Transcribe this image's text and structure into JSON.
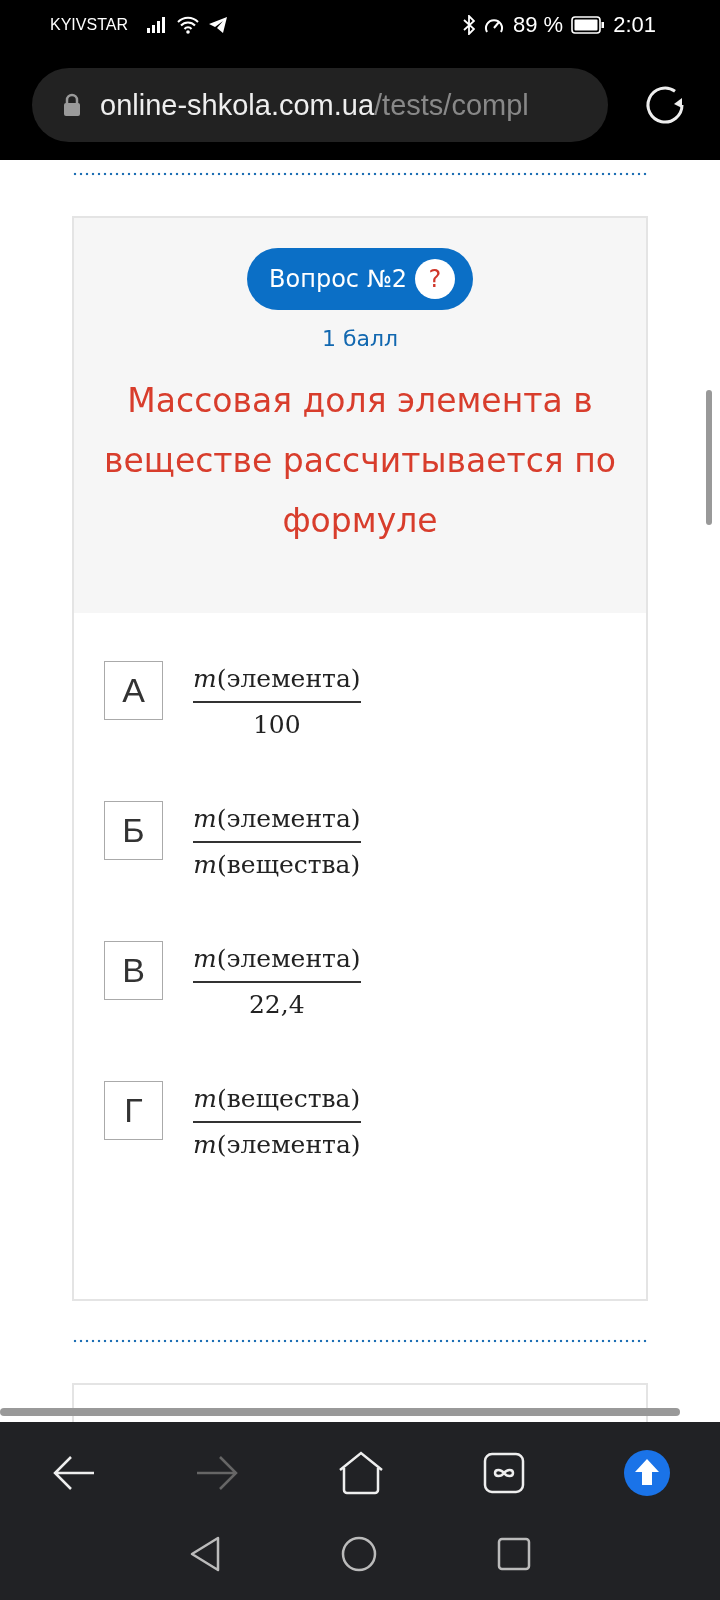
{
  "status_bar": {
    "carrier": "KYIVSTAR",
    "battery": "89 %",
    "time": "2:01"
  },
  "address_bar": {
    "host": "online-shkola.com.ua",
    "path": "/tests/compl"
  },
  "question": {
    "badge": "Вопрос №2",
    "help": "?",
    "points": "1 балл",
    "text": "Массовая доля элемента в веществе рассчитывается по формуле"
  },
  "options": [
    {
      "letter": "А",
      "numerator": "*m*(элемента)",
      "denominator": "100"
    },
    {
      "letter": "Б",
      "numerator": "*m*(элемента)",
      "denominator": "*m*(вещества)"
    },
    {
      "letter": "В",
      "numerator": "*m*(элемента)",
      "denominator": "22,4"
    },
    {
      "letter": "Г",
      "numerator": "*m*(вещества)",
      "denominator": "*m*(элемента)"
    }
  ]
}
